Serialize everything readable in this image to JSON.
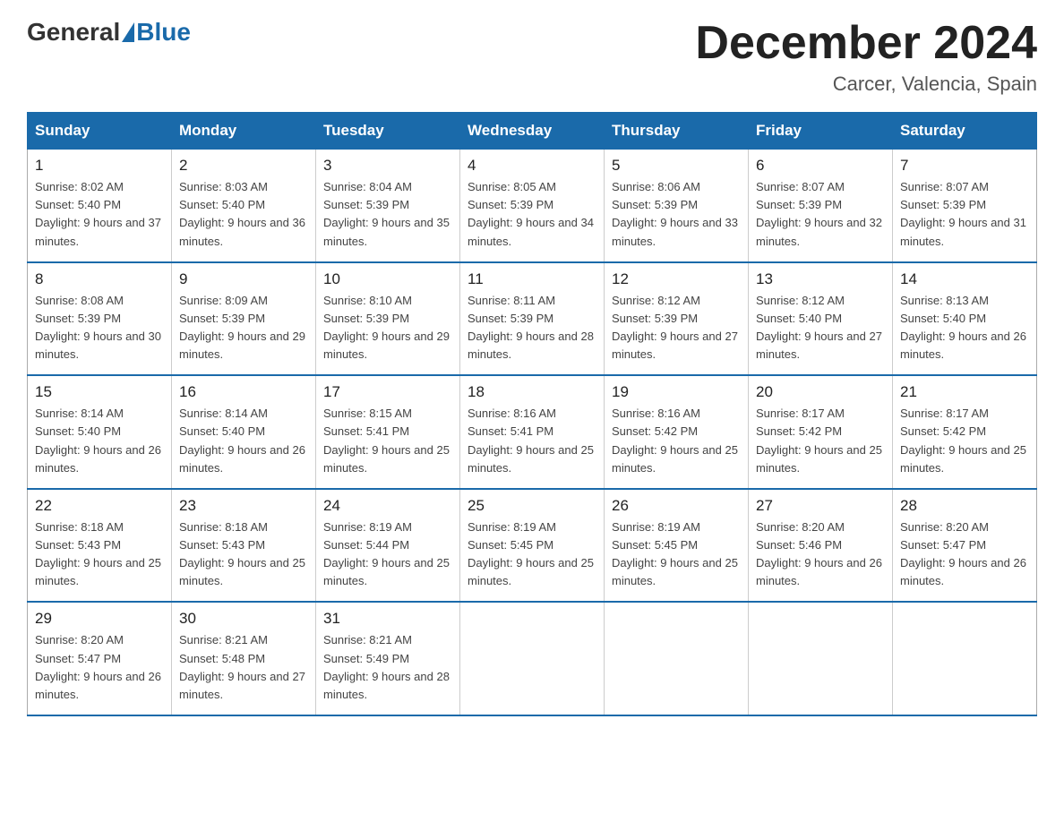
{
  "header": {
    "logo_general": "General",
    "logo_blue": "Blue",
    "month_title": "December 2024",
    "location": "Carcer, Valencia, Spain"
  },
  "days_of_week": [
    "Sunday",
    "Monday",
    "Tuesday",
    "Wednesday",
    "Thursday",
    "Friday",
    "Saturday"
  ],
  "weeks": [
    [
      {
        "day": "1",
        "sunrise": "8:02 AM",
        "sunset": "5:40 PM",
        "daylight": "9 hours and 37 minutes."
      },
      {
        "day": "2",
        "sunrise": "8:03 AM",
        "sunset": "5:40 PM",
        "daylight": "9 hours and 36 minutes."
      },
      {
        "day": "3",
        "sunrise": "8:04 AM",
        "sunset": "5:39 PM",
        "daylight": "9 hours and 35 minutes."
      },
      {
        "day": "4",
        "sunrise": "8:05 AM",
        "sunset": "5:39 PM",
        "daylight": "9 hours and 34 minutes."
      },
      {
        "day": "5",
        "sunrise": "8:06 AM",
        "sunset": "5:39 PM",
        "daylight": "9 hours and 33 minutes."
      },
      {
        "day": "6",
        "sunrise": "8:07 AM",
        "sunset": "5:39 PM",
        "daylight": "9 hours and 32 minutes."
      },
      {
        "day": "7",
        "sunrise": "8:07 AM",
        "sunset": "5:39 PM",
        "daylight": "9 hours and 31 minutes."
      }
    ],
    [
      {
        "day": "8",
        "sunrise": "8:08 AM",
        "sunset": "5:39 PM",
        "daylight": "9 hours and 30 minutes."
      },
      {
        "day": "9",
        "sunrise": "8:09 AM",
        "sunset": "5:39 PM",
        "daylight": "9 hours and 29 minutes."
      },
      {
        "day": "10",
        "sunrise": "8:10 AM",
        "sunset": "5:39 PM",
        "daylight": "9 hours and 29 minutes."
      },
      {
        "day": "11",
        "sunrise": "8:11 AM",
        "sunset": "5:39 PM",
        "daylight": "9 hours and 28 minutes."
      },
      {
        "day": "12",
        "sunrise": "8:12 AM",
        "sunset": "5:39 PM",
        "daylight": "9 hours and 27 minutes."
      },
      {
        "day": "13",
        "sunrise": "8:12 AM",
        "sunset": "5:40 PM",
        "daylight": "9 hours and 27 minutes."
      },
      {
        "day": "14",
        "sunrise": "8:13 AM",
        "sunset": "5:40 PM",
        "daylight": "9 hours and 26 minutes."
      }
    ],
    [
      {
        "day": "15",
        "sunrise": "8:14 AM",
        "sunset": "5:40 PM",
        "daylight": "9 hours and 26 minutes."
      },
      {
        "day": "16",
        "sunrise": "8:14 AM",
        "sunset": "5:40 PM",
        "daylight": "9 hours and 26 minutes."
      },
      {
        "day": "17",
        "sunrise": "8:15 AM",
        "sunset": "5:41 PM",
        "daylight": "9 hours and 25 minutes."
      },
      {
        "day": "18",
        "sunrise": "8:16 AM",
        "sunset": "5:41 PM",
        "daylight": "9 hours and 25 minutes."
      },
      {
        "day": "19",
        "sunrise": "8:16 AM",
        "sunset": "5:42 PM",
        "daylight": "9 hours and 25 minutes."
      },
      {
        "day": "20",
        "sunrise": "8:17 AM",
        "sunset": "5:42 PM",
        "daylight": "9 hours and 25 minutes."
      },
      {
        "day": "21",
        "sunrise": "8:17 AM",
        "sunset": "5:42 PM",
        "daylight": "9 hours and 25 minutes."
      }
    ],
    [
      {
        "day": "22",
        "sunrise": "8:18 AM",
        "sunset": "5:43 PM",
        "daylight": "9 hours and 25 minutes."
      },
      {
        "day": "23",
        "sunrise": "8:18 AM",
        "sunset": "5:43 PM",
        "daylight": "9 hours and 25 minutes."
      },
      {
        "day": "24",
        "sunrise": "8:19 AM",
        "sunset": "5:44 PM",
        "daylight": "9 hours and 25 minutes."
      },
      {
        "day": "25",
        "sunrise": "8:19 AM",
        "sunset": "5:45 PM",
        "daylight": "9 hours and 25 minutes."
      },
      {
        "day": "26",
        "sunrise": "8:19 AM",
        "sunset": "5:45 PM",
        "daylight": "9 hours and 25 minutes."
      },
      {
        "day": "27",
        "sunrise": "8:20 AM",
        "sunset": "5:46 PM",
        "daylight": "9 hours and 26 minutes."
      },
      {
        "day": "28",
        "sunrise": "8:20 AM",
        "sunset": "5:47 PM",
        "daylight": "9 hours and 26 minutes."
      }
    ],
    [
      {
        "day": "29",
        "sunrise": "8:20 AM",
        "sunset": "5:47 PM",
        "daylight": "9 hours and 26 minutes."
      },
      {
        "day": "30",
        "sunrise": "8:21 AM",
        "sunset": "5:48 PM",
        "daylight": "9 hours and 27 minutes."
      },
      {
        "day": "31",
        "sunrise": "8:21 AM",
        "sunset": "5:49 PM",
        "daylight": "9 hours and 28 minutes."
      },
      null,
      null,
      null,
      null
    ]
  ],
  "labels": {
    "sunrise_prefix": "Sunrise: ",
    "sunset_prefix": "Sunset: ",
    "daylight_prefix": "Daylight: "
  }
}
